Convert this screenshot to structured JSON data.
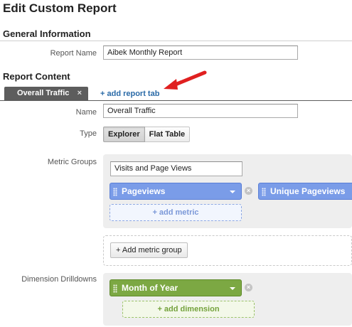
{
  "page": {
    "title": "Edit Custom Report"
  },
  "general": {
    "heading": "General Information",
    "report_name_label": "Report Name",
    "report_name_value": "Aibek Monthly Report"
  },
  "content": {
    "heading": "Report Content",
    "active_tab": "Overall Traffic",
    "tab_close": "×",
    "add_tab_link": "+ add report tab",
    "name_label": "Name",
    "name_value": "Overall Traffic",
    "type_label": "Type",
    "type_options": [
      "Explorer",
      "Flat Table"
    ],
    "type_selected": "Explorer",
    "metric_groups_label": "Metric Groups",
    "metric_group_name": "Visits and Page Views",
    "metrics": [
      "Pageviews",
      "Unique Pageviews"
    ],
    "add_metric": "+ add metric",
    "add_metric_group": "+ Add metric group",
    "dimension_label": "Dimension Drilldowns",
    "dimensions": [
      "Month of Year"
    ],
    "add_dimension": "+ add dimension"
  },
  "colors": {
    "metric_chip": "#7a9ce8",
    "dimension_chip": "#7ca843",
    "link": "#2a6aa7",
    "arrow": "#e02020",
    "tab": "#5d5d5d"
  },
  "icons": {
    "remove": "remove-circle-icon",
    "caret": "caret-down-icon",
    "grip": "drag-grip-icon",
    "arrow": "red-arrow-icon"
  }
}
